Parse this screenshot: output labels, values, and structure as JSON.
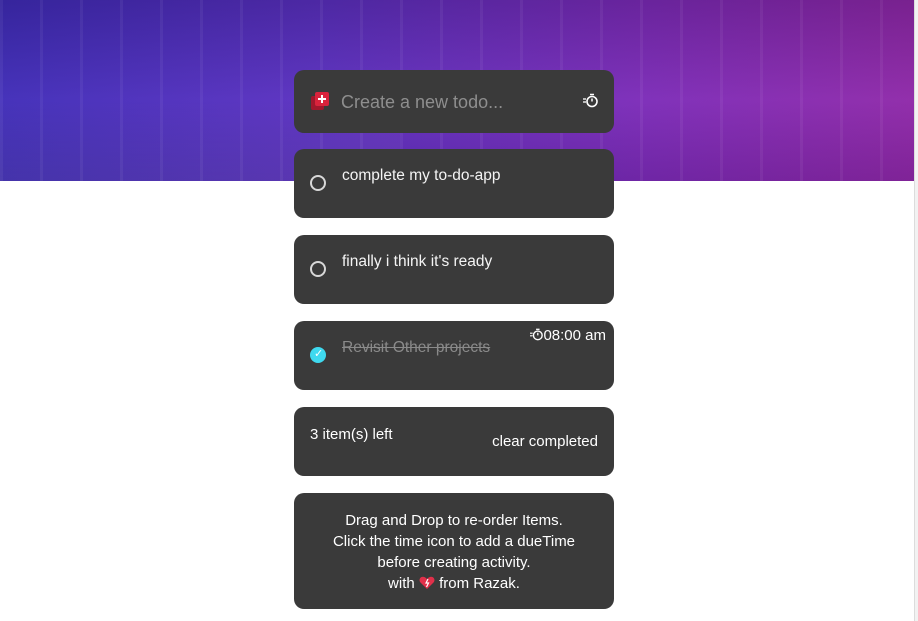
{
  "create": {
    "placeholder": "Create a new todo...",
    "add_icon": "add-box-icon",
    "timer_icon": "timer-icon"
  },
  "todos": [
    {
      "text": "complete my to-do-app",
      "completed": false,
      "due": ""
    },
    {
      "text": "finally i think it's ready",
      "completed": false,
      "due": ""
    },
    {
      "text": "Revisit Other projects",
      "completed": true,
      "due": "08:00 am"
    }
  ],
  "footer": {
    "items_left": "3 item(s) left",
    "clear_label": "clear completed"
  },
  "info": {
    "line1": "Drag and Drop to re-order Items.",
    "line2": "Click the time icon to add a dueTime",
    "line3": "before creating activity.",
    "line4_prefix": "with",
    "line4_suffix": "from Razak.",
    "heart_icon": "heart-icon"
  },
  "colors": {
    "card": "#3a3a3a",
    "accent_check": "#3fd9ef",
    "add_icon": "#d9233c",
    "hero_start": "#3f2bb8",
    "hero_end": "#8e27a8"
  }
}
